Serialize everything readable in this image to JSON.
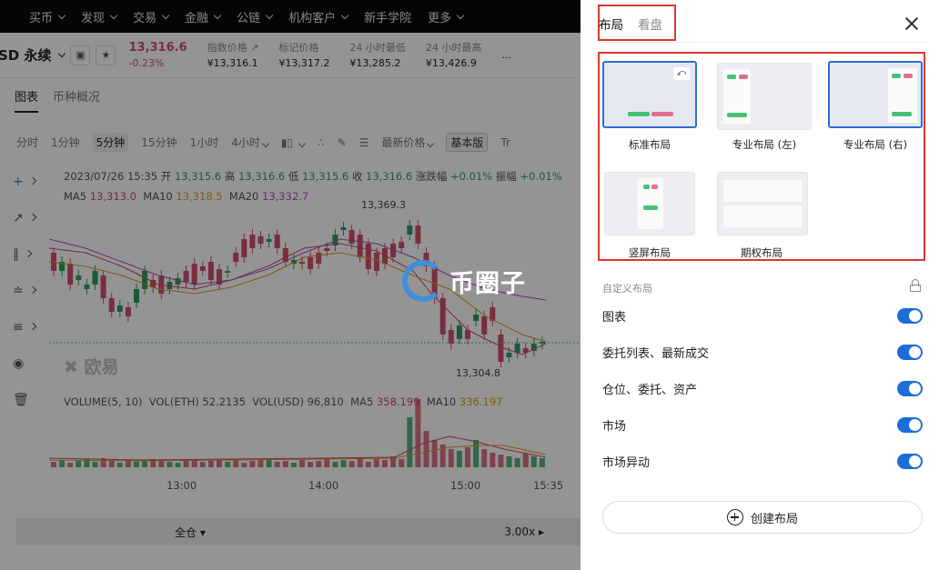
{
  "nav": [
    "买币",
    "发现",
    "交易",
    "金融",
    "公链",
    "机构客户",
    "新手学院",
    "更多"
  ],
  "ticker": {
    "pair": "SD 永续",
    "price": "13,316.6",
    "change": "-0.23%",
    "stats": [
      {
        "k": "指数价格",
        "v": "¥13,316.1"
      },
      {
        "k": "标记价格",
        "v": "¥13,317.2"
      },
      {
        "k": "24 小时最低",
        "v": "¥13,285.2"
      },
      {
        "k": "24 小时最高",
        "v": "¥13,426.9"
      }
    ],
    "more": "..."
  },
  "tabs": {
    "chart": "图表",
    "overview": "币种概况"
  },
  "timeframes": {
    "t1": "分时",
    "t2": "1分钟",
    "t3": "5分钟",
    "t4": "15分钟",
    "t5": "1小时",
    "t6": "4小时",
    "latest": "最新价格",
    "basic": "基本版",
    "tv": "Tr"
  },
  "ohlc": {
    "date": "2023/07/26 15:35",
    "open_k": "开",
    "open": "13,315.6",
    "high_k": "高",
    "high": "13,316.6",
    "low_k": "低",
    "low": "13,315.6",
    "close_k": "收",
    "close": "13,316.6",
    "chg_k": "涨跌幅",
    "chg": "+0.01%",
    "amp_k": "振幅",
    "amp": "+0.01%"
  },
  "ma": {
    "m5k": "MA5",
    "m5": "13,313.0",
    "m10k": "MA10",
    "m10": "13,318.5",
    "m20k": "MA20",
    "m20": "13,332.7"
  },
  "annotations": {
    "high": "13,369.3",
    "low": "13,304.8"
  },
  "volume": {
    "label": "VOLUME(5, 10)",
    "eth_k": "VOL(ETH)",
    "eth": "52.2135",
    "usd_k": "VOL(USD)",
    "usd": "96,810",
    "ma5k": "MA5",
    "ma5": "358.199",
    "ma10k": "MA10",
    "ma10": "336.197"
  },
  "xaxis": [
    "13:00",
    "14:00",
    "15:00",
    "15:35"
  ],
  "watermark": "欧易",
  "logo_text": "币圈子",
  "bottombar": {
    "margin": "全仓",
    "leverage": "3.00x"
  },
  "panel": {
    "tab_layout": "布局",
    "tab_board": "看盘",
    "layouts": [
      "标准布局",
      "专业布局 (左)",
      "专业布局 (右)",
      "竖屏布局",
      "期权布局"
    ],
    "custom_title": "自定义布局",
    "toggles": [
      "图表",
      "委托列表、最新成交",
      "仓位、委托、资产",
      "市场",
      "市场异动"
    ],
    "create": "创建布局"
  },
  "colors": {
    "accent": "#1c6dd8",
    "highlight": "#d9392c",
    "up": "#2c9e5c",
    "down": "#d24f6b"
  }
}
